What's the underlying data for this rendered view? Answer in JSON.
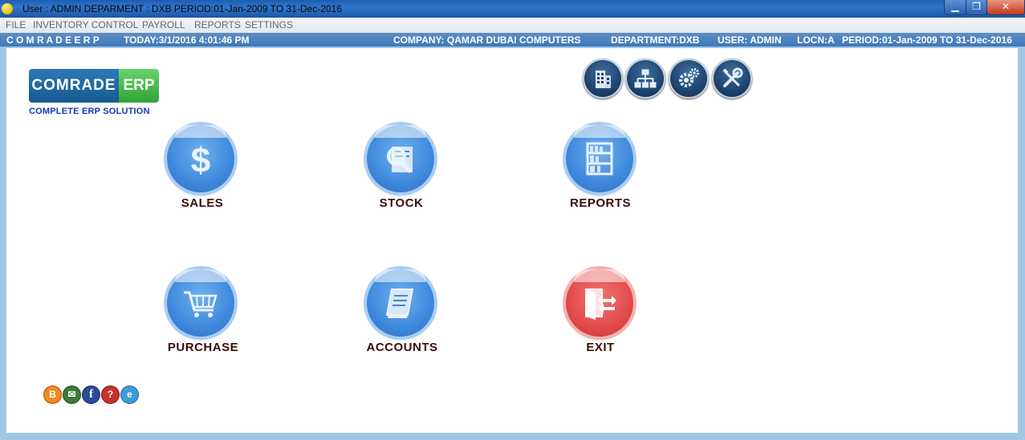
{
  "window": {
    "title": "User : ADMIN  DEPARMENT : DXB      PERIOD:01-Jan-2009 TO 31-Dec-2016",
    "minimize": "▁",
    "maximize": "❐",
    "close": "✕"
  },
  "menu": [
    "FILE",
    "INVENTORY CONTROL",
    "PAYROLL",
    "REPORTS",
    "SETTINGS"
  ],
  "status": {
    "brand": "C O M R A D E  E R P",
    "today": "TODAY:3/1/2016 4:01:46 PM",
    "company": "COMPANY: QAMAR DUBAI COMPUTERS",
    "department": "DEPARTMENT:DXB",
    "user": "USER: ADMIN",
    "location": "LOCN:A",
    "period": "PERIOD:01-Jan-2009 TO 31-Dec-2016"
  },
  "logo": {
    "part1": "COMRADE",
    "part2": "ERP",
    "tagline": "COMPLETE ERP SOLUTION"
  },
  "toolbar_icons": [
    "building-icon",
    "org-chart-icon",
    "gears-icon",
    "tools-icon"
  ],
  "modules": {
    "sales": "SALES",
    "stock": "STOCK",
    "reports": "REPORTS",
    "purchase": "PURCHASE",
    "accounts": "ACCOUNTS",
    "exit": "EXIT"
  },
  "footer_icons": {
    "blogger": "B",
    "email": "✉",
    "facebook": "f",
    "help": "?",
    "web": "e"
  },
  "colors": {
    "module_blue": "#3f88dc",
    "module_red": "#e34b4b",
    "label": "#3b0c0c",
    "status_bar": "#4a82bd"
  }
}
